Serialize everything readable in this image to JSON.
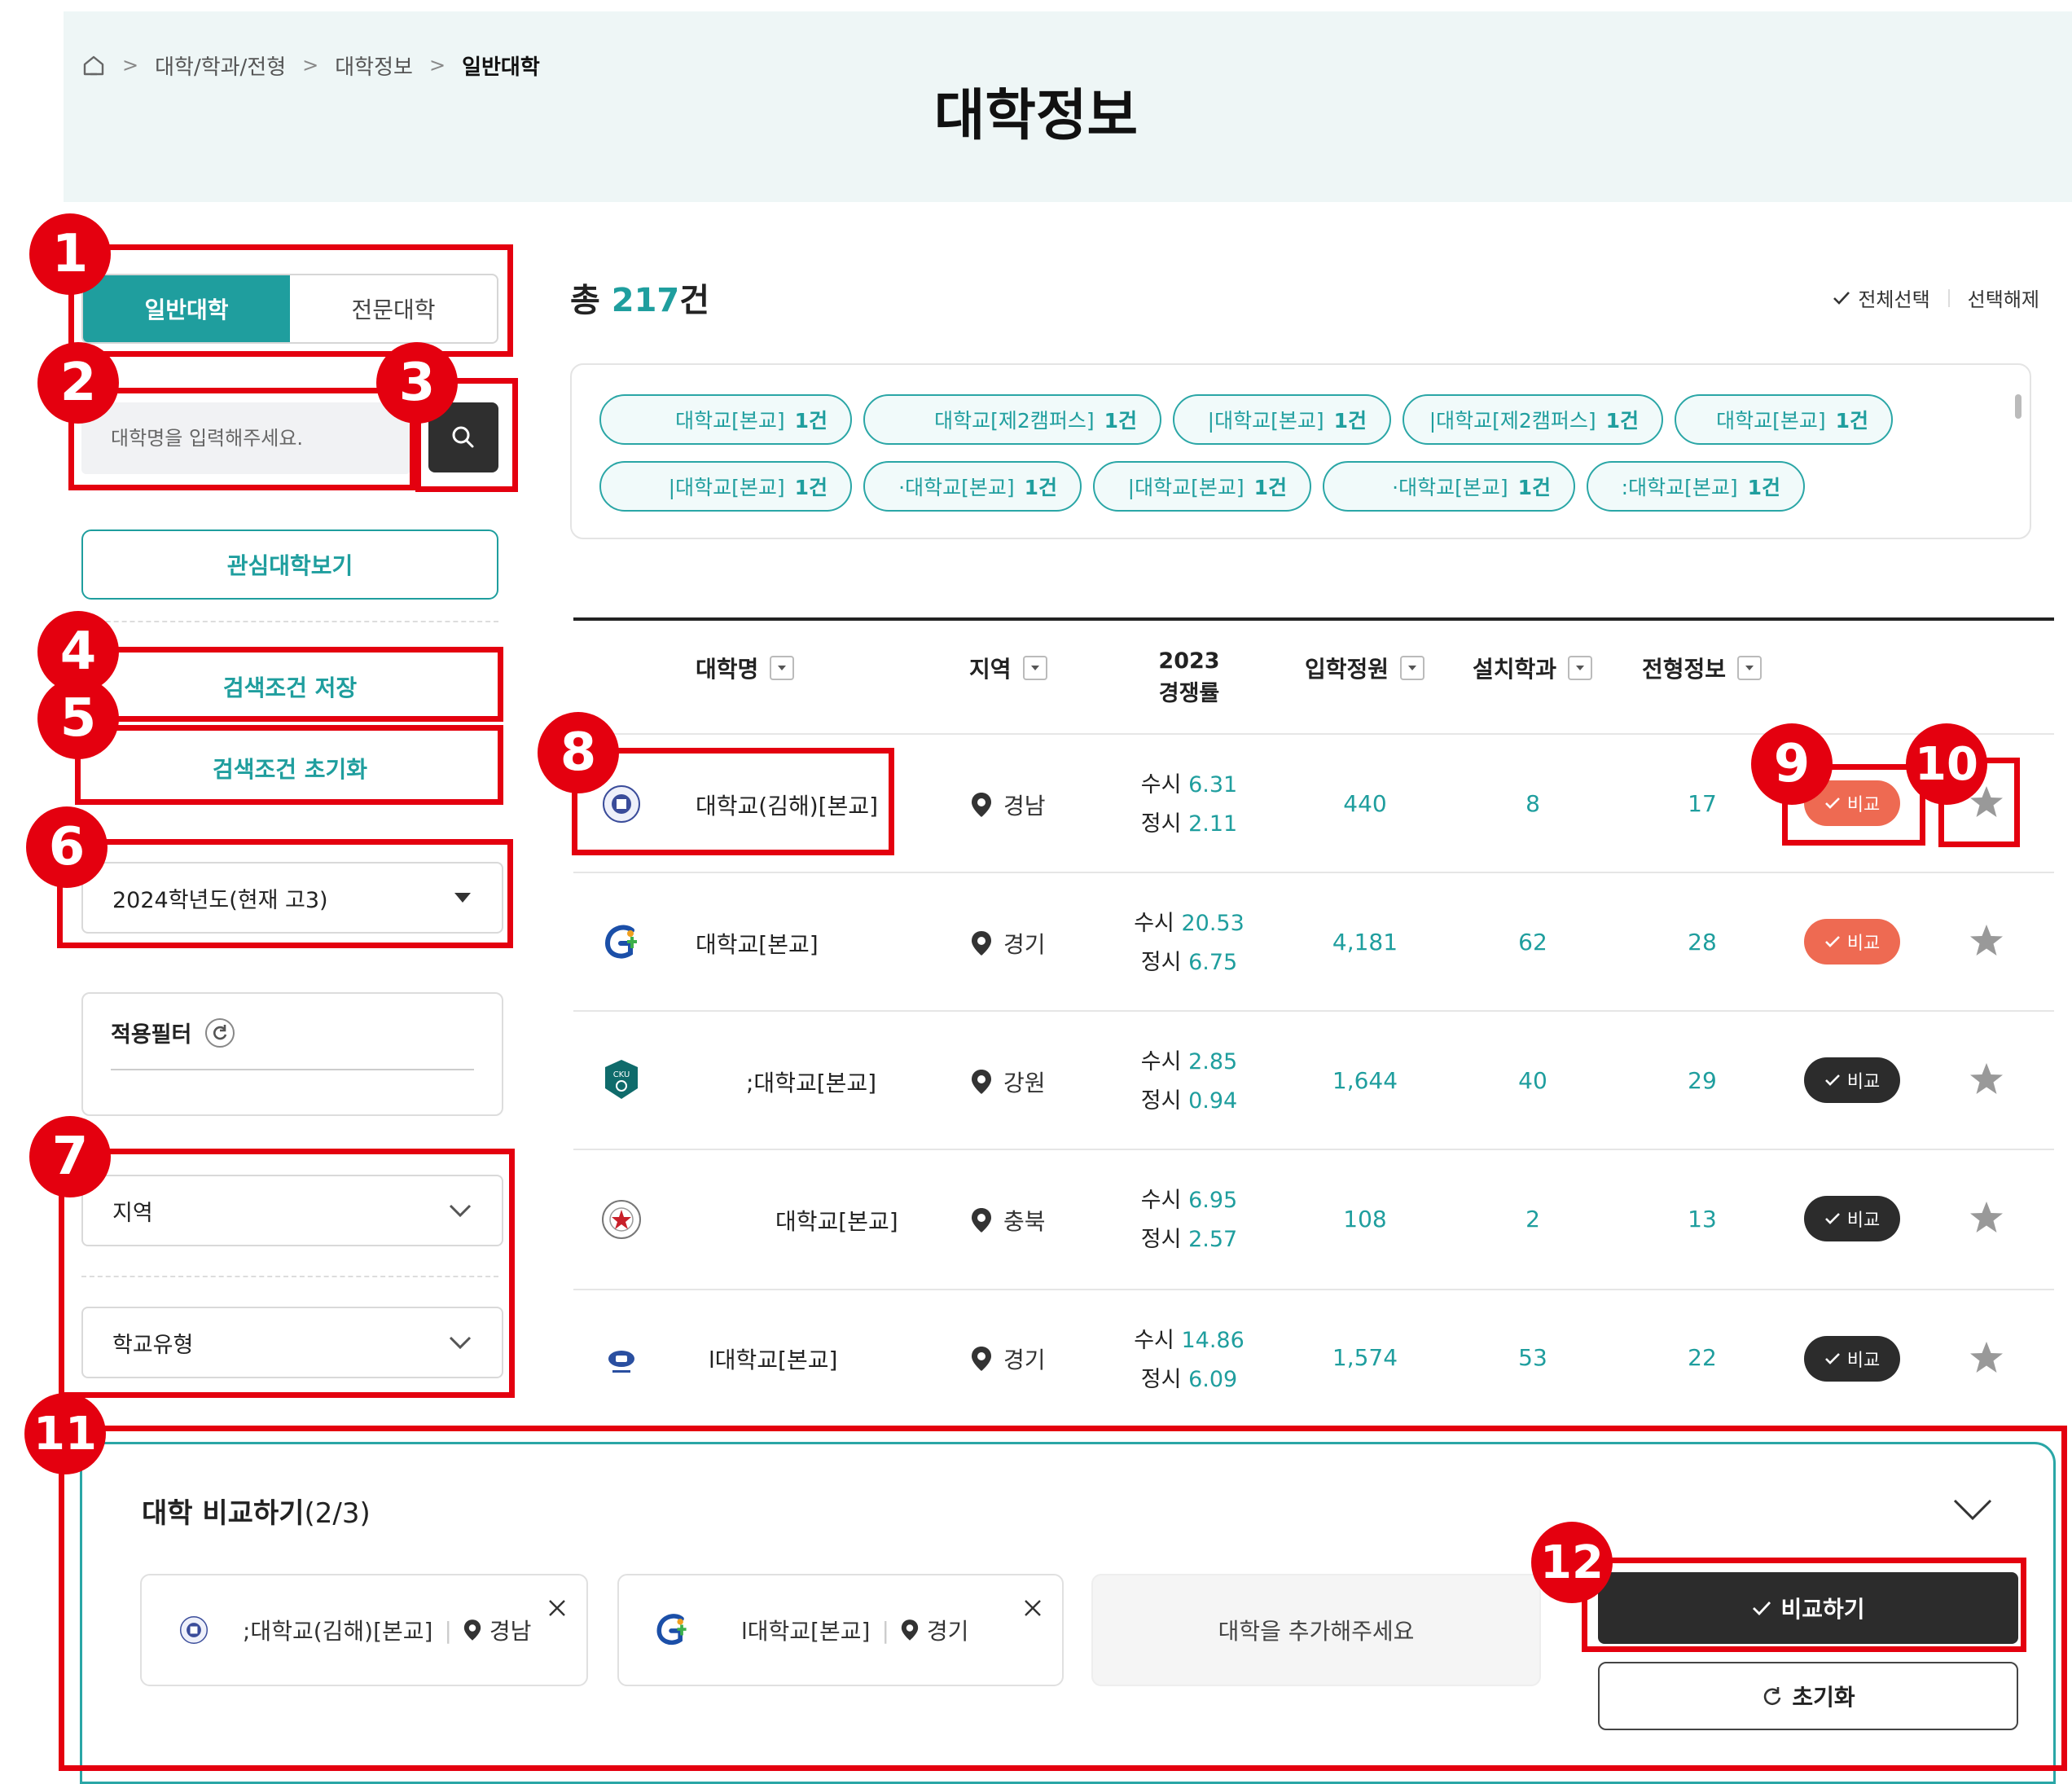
{
  "breadcrumb": {
    "items": [
      "대학/학과/전형",
      "대학정보",
      "일반대학"
    ]
  },
  "page_title": "대학정보",
  "tabs": {
    "general": "일반대학",
    "specialized": "전문대학"
  },
  "search": {
    "placeholder": "대학명을 입력해주세요."
  },
  "sidebar": {
    "interest_label": "관심대학보기",
    "save_label": "검색조건 저장",
    "reset_label": "검색조건 초기화",
    "year_select": "2024학년도(현재 고3)",
    "applied_filter_label": "적용필터",
    "region_filter": "지역",
    "school_type_filter": "학교유형"
  },
  "results": {
    "total_prefix": "총",
    "total_count": "217",
    "total_suffix": "건",
    "select_all": "전체선택",
    "deselect": "선택해제"
  },
  "chips": [
    {
      "label": "대학교[본교]",
      "count": "1건"
    },
    {
      "label": "대학교[제2캠퍼스]",
      "count": "1건"
    },
    {
      "label": "|대학교[본교]",
      "count": "1건"
    },
    {
      "label": "|대학교[제2캠퍼스]",
      "count": "1건"
    },
    {
      "label": "대학교[본교]",
      "count": "1건"
    },
    {
      "label": "|대학교[본교]",
      "count": "1건"
    },
    {
      "label": "·대학교[본교]",
      "count": "1건"
    },
    {
      "label": "|대학교[본교]",
      "count": "1건"
    },
    {
      "label": "·대학교[본교]",
      "count": "1건"
    },
    {
      "label": ":대학교[본교]",
      "count": "1건"
    }
  ],
  "table": {
    "headers": {
      "name": "대학명",
      "region": "지역",
      "comp_year": "2023",
      "comp_label": "경쟁률",
      "quota": "입학정원",
      "depts": "설치학과",
      "admission": "전형정보"
    },
    "rows": [
      {
        "name": "대학교(김해)[본교]",
        "region": "경남",
        "susi_label": "수시",
        "susi": "6.31",
        "jungsi_label": "정시",
        "jungsi": "2.11",
        "quota": "440",
        "depts": "8",
        "admission": "17",
        "compare": "비교",
        "compare_selected": true
      },
      {
        "name": "대학교[본교]",
        "region": "경기",
        "susi_label": "수시",
        "susi": "20.53",
        "jungsi_label": "정시",
        "jungsi": "6.75",
        "quota": "4,181",
        "depts": "62",
        "admission": "28",
        "compare": "비교",
        "compare_selected": true
      },
      {
        "name": ";대학교[본교]",
        "region": "강원",
        "susi_label": "수시",
        "susi": "2.85",
        "jungsi_label": "정시",
        "jungsi": "0.94",
        "quota": "1,644",
        "depts": "40",
        "admission": "29",
        "compare": "비교",
        "compare_selected": false
      },
      {
        "name": "대학교[본교]",
        "region": "충북",
        "susi_label": "수시",
        "susi": "6.95",
        "jungsi_label": "정시",
        "jungsi": "2.57",
        "quota": "108",
        "depts": "2",
        "admission": "13",
        "compare": "비교",
        "compare_selected": false
      },
      {
        "name": "l대학교[본교]",
        "region": "경기",
        "susi_label": "수시",
        "susi": "14.86",
        "jungsi_label": "정시",
        "jungsi": "6.09",
        "quota": "1,574",
        "depts": "53",
        "admission": "22",
        "compare": "비교",
        "compare_selected": false
      }
    ]
  },
  "compare_panel": {
    "title": "대학 비교하기",
    "count": "(2/3)",
    "items": [
      {
        "name": ";대학교(김해)[본교]",
        "region": "경남"
      },
      {
        "name": "l대학교[본교]",
        "region": "경기"
      }
    ],
    "empty_label": "대학을 추가해주세요",
    "compare_button": "비교하기",
    "reset_button": "초기화"
  },
  "annotations": [
    "1",
    "2",
    "3",
    "4",
    "5",
    "6",
    "7",
    "8",
    "9",
    "10",
    "11",
    "12"
  ],
  "colors": {
    "accent": "#1f9e9e",
    "compare_selected": "#ee6a52",
    "compare_default": "#2c2c2c",
    "annotation": "#e4000f"
  }
}
